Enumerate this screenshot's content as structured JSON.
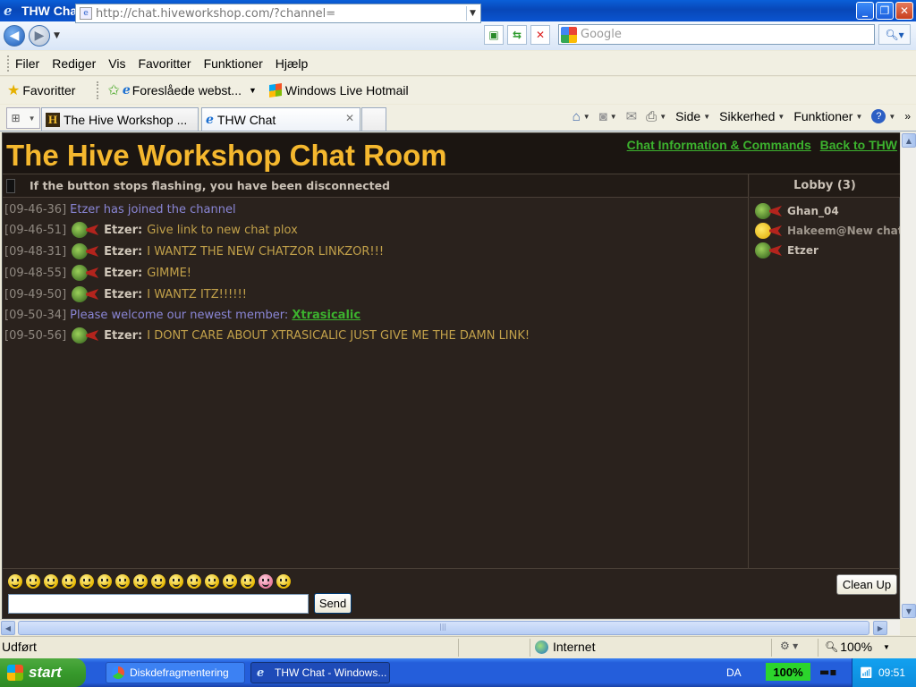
{
  "window": {
    "title": "THW Chat - Windows Internet Explorer"
  },
  "address_bar": {
    "url": "http://chat.hiveworkshop.com/?channel="
  },
  "search": {
    "placeholder": "Google"
  },
  "menu": {
    "items": [
      "Filer",
      "Rediger",
      "Vis",
      "Favoritter",
      "Funktioner",
      "Hjælp"
    ]
  },
  "favorites_bar": {
    "favorites_label": "Favoritter",
    "suggested": "Foreslåede webst...",
    "hotmail": "Windows Live Hotmail"
  },
  "tabs": [
    {
      "label": "The Hive Workshop ..."
    },
    {
      "label": "THW Chat"
    }
  ],
  "command_bar": {
    "page": "Side",
    "safety": "Sikkerhed",
    "tools": "Funktioner"
  },
  "chat": {
    "room_title": "The Hive Workshop Chat Room",
    "link_info": "Chat Information & Commands",
    "link_back": "Back to THW",
    "notice": "If the button stops flashing, you have been disconnected",
    "messages": [
      {
        "ts": "[09-46-36]",
        "system": "Etzer has joined the channel"
      },
      {
        "ts": "[09-46-51]",
        "nick": "Etzer:",
        "text": "Give link to new chat plox"
      },
      {
        "ts": "[09-48-31]",
        "nick": "Etzer:",
        "text": "I WANTZ THE NEW CHATZOR LINKZOR!!!"
      },
      {
        "ts": "[09-48-55]",
        "nick": "Etzer:",
        "text": "GIMME!"
      },
      {
        "ts": "[09-49-50]",
        "nick": "Etzer:",
        "text": "I WANTZ ITZ!!!!!!"
      },
      {
        "ts": "[09-50-34]",
        "system": "Please welcome our newest member: ",
        "link": "Xtrasicalic"
      },
      {
        "ts": "[09-50-56]",
        "nick": "Etzer:",
        "text": "I DONT CARE ABOUT XTRASICALIC JUST GIVE ME THE DAMN LINK!"
      }
    ],
    "lobby_title": "Lobby (3)",
    "lobby_users": [
      "Ghan_04",
      "Hakeem@New chat...",
      "Etzer"
    ],
    "send_label": "Send",
    "cleanup_label": "Clean Up",
    "message_value": ""
  },
  "status_bar": {
    "status": "Udført",
    "zone": "Internet",
    "zoom": "100%"
  },
  "taskbar": {
    "start": "start",
    "tasks": [
      "Diskdefragmentering",
      "THW Chat - Windows..."
    ],
    "language": "DA",
    "battery": "100%",
    "clock": "09:51"
  },
  "colors": {
    "title_gold": "#f5b82e",
    "link_green": "#3cb22e",
    "chat_bg": "#2a221d",
    "system_text": "#8a86d6",
    "message_text": "#c2a14a"
  }
}
